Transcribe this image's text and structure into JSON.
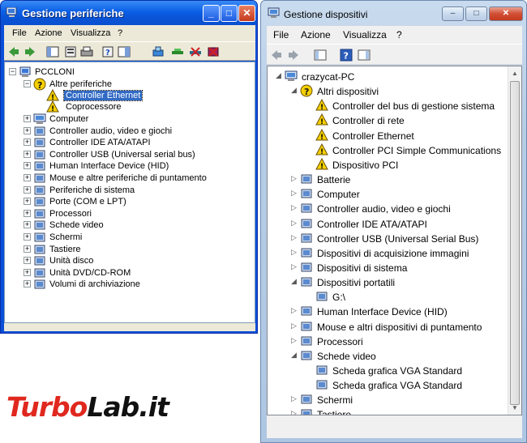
{
  "xp_window": {
    "title": "Gestione periferiche",
    "title_buttons": {
      "minimize": "_",
      "maximize": "□",
      "close": "✕"
    },
    "menu": [
      "File",
      "Azione",
      "Visualizza",
      "?"
    ],
    "toolbar_icons": [
      "back-arrow-icon",
      "forward-arrow-icon",
      "show-hide-console-icon",
      "properties-icon",
      "print-icon",
      "help-icon",
      "console-tree-icon",
      "scan-hardware-icon",
      "update-driver-icon",
      "disable-icon",
      "uninstall-icon"
    ],
    "tree": {
      "root": "PCCLONI",
      "other_devices_label": "Altre periferiche",
      "other_devices_children": [
        "Controller Ethernet",
        "Coprocessore"
      ],
      "selected": "Controller Ethernet",
      "categories": [
        "Computer",
        "Controller audio, video e giochi",
        "Controller IDE ATA/ATAPI",
        "Controller USB (Universal serial bus)",
        "Human Interface Device (HID)",
        "Mouse e altre periferiche di puntamento",
        "Periferiche di sistema",
        "Porte (COM e LPT)",
        "Processori",
        "Schede video",
        "Schermi",
        "Tastiere",
        "Unità disco",
        "Unità DVD/CD-ROM",
        "Volumi di archiviazione"
      ]
    }
  },
  "vista_window": {
    "title": "Gestione dispositivi",
    "title_buttons": {
      "minimize": "–",
      "maximize": "□",
      "close": "✕"
    },
    "menu": [
      "File",
      "Azione",
      "Visualizza",
      "?"
    ],
    "toolbar_icons": [
      "back-arrow-icon",
      "forward-arrow-icon",
      "show-hide-console-icon",
      "help-icon",
      "console-tree-icon"
    ],
    "tree": {
      "root": "crazycat-PC",
      "other_devices_label": "Altri dispositivi",
      "other_devices_children": [
        "Controller del bus di gestione sistema",
        "Controller di rete",
        "Controller Ethernet",
        "Controller PCI Simple Communications",
        "Dispositivo PCI"
      ],
      "group_a": [
        "Batterie",
        "Computer",
        "Controller audio, video e giochi",
        "Controller IDE ATA/ATAPI",
        "Controller USB (Universal Serial Bus)",
        "Dispositivi di acquisizione immagini",
        "Dispositivi di sistema"
      ],
      "portable_label": "Dispositivi portatili",
      "portable_children": [
        "G:\\"
      ],
      "group_b": [
        "Human Interface Device (HID)",
        "Mouse e altri dispositivi di puntamento",
        "Processori"
      ],
      "video_label": "Schede video",
      "video_children": [
        "Scheda grafica VGA Standard",
        "Scheda grafica VGA Standard"
      ],
      "group_c": [
        "Schermi",
        "Tastiere"
      ]
    }
  },
  "watermark": {
    "part1": "Turbo",
    "part2": "Lab.it"
  },
  "colors": {
    "xp_title_blue": "#0b5fe6",
    "xp_selection": "#316ac5",
    "warning_yellow": "#f5d000",
    "watermark_red": "#e0281e"
  }
}
